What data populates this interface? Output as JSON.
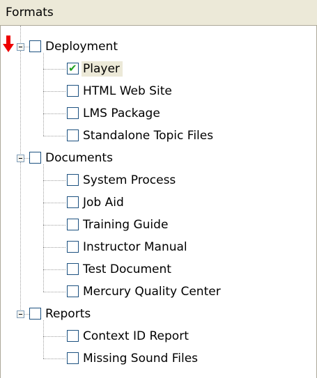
{
  "panel": {
    "title": "Formats"
  },
  "colors": {
    "header_bg": "#ece9d8",
    "checkbox_border": "#1c5180",
    "check_mark": "#21a121",
    "selection_bg": "#ece9d8",
    "marker": "#ee0000"
  },
  "marker_icon": "red-down-arrow",
  "check_glyph": "✔",
  "tree": {
    "groups": [
      {
        "label": "Deployment",
        "checked": false,
        "expanded": true,
        "items": [
          {
            "label": "Player",
            "checked": true,
            "selected": true
          },
          {
            "label": "HTML Web Site",
            "checked": false
          },
          {
            "label": "LMS Package",
            "checked": false
          },
          {
            "label": "Standalone Topic Files",
            "checked": false
          }
        ]
      },
      {
        "label": "Documents",
        "checked": false,
        "expanded": true,
        "items": [
          {
            "label": "System Process",
            "checked": false
          },
          {
            "label": "Job Aid",
            "checked": false
          },
          {
            "label": "Training Guide",
            "checked": false
          },
          {
            "label": "Instructor Manual",
            "checked": false
          },
          {
            "label": "Test Document",
            "checked": false
          },
          {
            "label": "Mercury Quality Center",
            "checked": false
          }
        ]
      },
      {
        "label": "Reports",
        "checked": false,
        "expanded": true,
        "items": [
          {
            "label": "Context ID Report",
            "checked": false
          },
          {
            "label": "Missing Sound Files",
            "checked": false
          }
        ]
      }
    ]
  }
}
